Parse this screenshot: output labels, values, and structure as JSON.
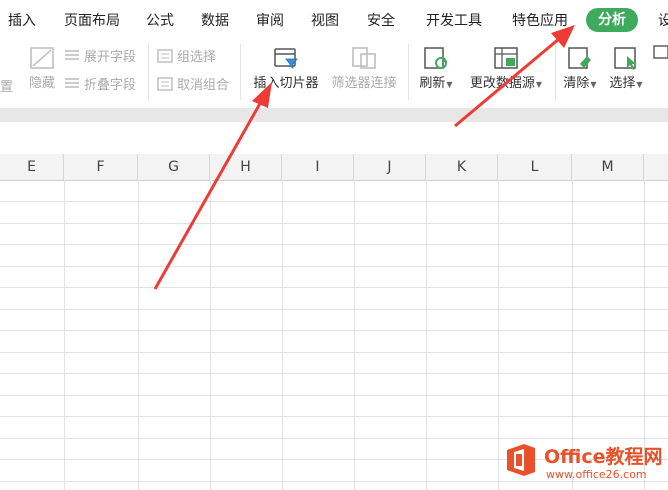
{
  "menu": {
    "tabs": [
      {
        "label": "插入"
      },
      {
        "label": "页面布局"
      },
      {
        "label": "公式"
      },
      {
        "label": "数据"
      },
      {
        "label": "审阅"
      },
      {
        "label": "视图"
      },
      {
        "label": "安全"
      },
      {
        "label": "开发工具"
      },
      {
        "label": "特色应用"
      },
      {
        "label": "分析",
        "active": true
      },
      {
        "label": "设"
      }
    ],
    "active_color": "#3daa5c"
  },
  "ribbon": {
    "left_partial": "置",
    "hide_label": "隐藏",
    "expand_field": "展开字段",
    "collapse_field": "折叠字段",
    "group_select": "组选择",
    "ungroup": "取消组合",
    "insert_slicer": "插入切片器",
    "filter_connection": "筛选器连接",
    "refresh": "刷新",
    "change_source": "更改数据源",
    "clear": "清除",
    "select": "选择"
  },
  "columns": [
    "E",
    "F",
    "G",
    "H",
    "I",
    "J",
    "K",
    "L",
    "M"
  ],
  "watermark": {
    "brand": "Office教程网",
    "url": "www.office26.com",
    "color": "#e8512a"
  },
  "annotation_color": "#ee3b36"
}
